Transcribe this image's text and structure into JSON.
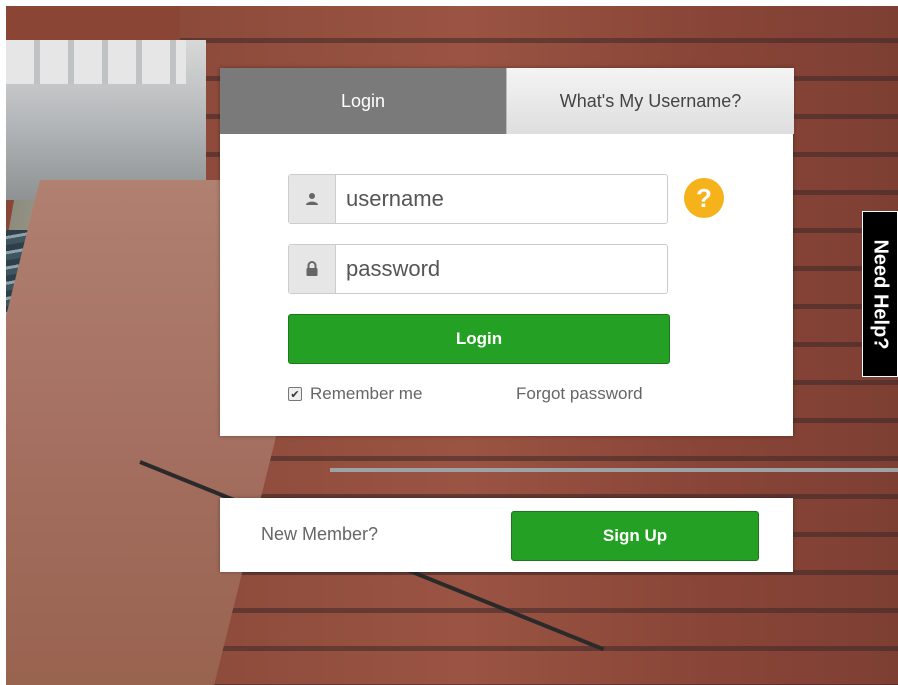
{
  "tabs": [
    {
      "label": "Login",
      "active": true
    },
    {
      "label": "What's My Username?",
      "active": false
    }
  ],
  "form": {
    "username_placeholder": "username",
    "password_placeholder": "password",
    "username_icon": "user-icon",
    "password_icon": "lock-icon",
    "help_icon_label": "?",
    "login_label": "Login",
    "remember_label": "Remember me",
    "remember_checked": true,
    "forgot_label": "Forgot password"
  },
  "signup": {
    "prompt": "New Member?",
    "button_label": "Sign Up"
  },
  "side_tab": {
    "label": "Need Help?"
  },
  "colors": {
    "primary_green": "#24a024",
    "help_yellow": "#f6b21b",
    "active_tab": "#7a7a7a"
  }
}
